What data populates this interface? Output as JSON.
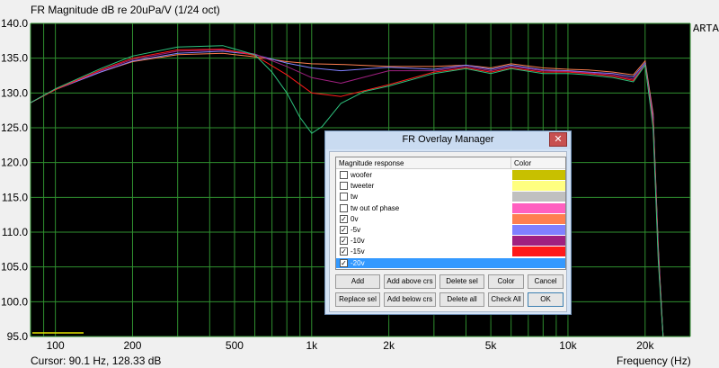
{
  "title": "FR Magnitude dB re 20uPa/V (1/24 oct)",
  "arta_label": "ARTA",
  "cursor_readout": "Cursor: 90.1 Hz, 128.33 dB",
  "chart_data": {
    "type": "line",
    "title": "FR Magnitude dB re 20uPa/V (1/24 oct)",
    "xlabel": "Frequency (Hz)",
    "ylabel": "",
    "xscale": "log",
    "xlim": [
      80,
      30000
    ],
    "ylim": [
      95,
      140
    ],
    "x_ticks": [
      100,
      200,
      500,
      1000,
      2000,
      5000,
      10000,
      20000
    ],
    "x_tick_labels": [
      "100",
      "200",
      "500",
      "1k",
      "2k",
      "5k",
      "10k",
      "20k"
    ],
    "y_ticks": [
      95,
      100,
      105,
      110,
      115,
      120,
      125,
      130,
      135,
      140
    ],
    "y_tick_labels": [
      "95.0",
      "100.0",
      "105.0",
      "110.0",
      "115.0",
      "120.0",
      "125.0",
      "130.0",
      "135.0",
      "140.0"
    ],
    "grid": true,
    "background": "#000000",
    "grid_color": "#2f8f2f",
    "series": [
      {
        "color": "#ff7f50",
        "x": [
          80,
          100,
          150,
          200,
          300,
          450,
          600,
          800,
          1000,
          1300,
          2000,
          3000,
          4000,
          5000,
          6000,
          8000,
          10000,
          12000,
          15000,
          18000,
          20000,
          21500,
          22500,
          23500
        ],
        "y": [
          128.6,
          130.5,
          133.0,
          134.5,
          135.5,
          135.7,
          135.2,
          134.5,
          134.2,
          134.1,
          133.8,
          133.8,
          134.0,
          133.6,
          134.2,
          133.6,
          133.4,
          133.3,
          133.0,
          132.6,
          134.6,
          127.0,
          108.0,
          95.0
        ]
      },
      {
        "color": "#8080ff",
        "x": [
          80,
          100,
          150,
          200,
          300,
          450,
          600,
          800,
          1000,
          1300,
          2000,
          3000,
          4000,
          5000,
          6000,
          8000,
          10000,
          12000,
          15000,
          18000,
          20000,
          21500,
          22500,
          23500
        ],
        "y": [
          128.6,
          130.5,
          133.0,
          134.6,
          135.7,
          136.0,
          135.5,
          134.3,
          133.6,
          133.2,
          133.7,
          133.4,
          134.0,
          133.4,
          134.0,
          133.3,
          133.2,
          133.0,
          132.8,
          132.3,
          134.3,
          126.5,
          107.5,
          95.0
        ]
      },
      {
        "color": "#a02080",
        "x": [
          80,
          100,
          150,
          200,
          300,
          450,
          600,
          800,
          1000,
          1300,
          2000,
          3000,
          4000,
          5000,
          6000,
          8000,
          10000,
          12000,
          15000,
          18000,
          20000,
          21500,
          22500,
          23500
        ],
        "y": [
          128.6,
          130.5,
          133.2,
          134.8,
          136.0,
          136.2,
          135.6,
          133.8,
          132.2,
          131.4,
          133.2,
          133.2,
          133.8,
          133.2,
          133.8,
          133.2,
          133.1,
          132.9,
          132.6,
          132.0,
          134.1,
          126.0,
          107.0,
          95.0
        ]
      },
      {
        "color": "#ff1a1a",
        "x": [
          80,
          100,
          150,
          200,
          300,
          450,
          600,
          800,
          1000,
          1300,
          2000,
          3000,
          4000,
          5000,
          6000,
          8000,
          10000,
          12000,
          15000,
          18000,
          20000,
          21500,
          22500,
          23500
        ],
        "y": [
          128.6,
          130.5,
          133.3,
          135.0,
          136.2,
          136.3,
          135.4,
          132.6,
          130.0,
          129.5,
          131.2,
          133.0,
          133.6,
          133.0,
          133.6,
          133.0,
          133.0,
          132.8,
          132.4,
          131.8,
          134.0,
          125.5,
          106.5,
          95.0
        ]
      },
      {
        "color": "#2ec27e",
        "x": [
          80,
          100,
          150,
          200,
          300,
          450,
          600,
          700,
          800,
          900,
          1000,
          1100,
          1300,
          1600,
          2000,
          3000,
          4000,
          5000,
          6000,
          8000,
          10000,
          12000,
          15000,
          18000,
          20000,
          21500,
          22500,
          23500
        ],
        "y": [
          128.6,
          130.6,
          133.5,
          135.3,
          136.6,
          136.8,
          135.5,
          133.0,
          130.0,
          126.5,
          124.2,
          125.2,
          128.5,
          130.2,
          131.0,
          132.8,
          133.5,
          132.8,
          133.5,
          132.8,
          132.8,
          132.6,
          132.2,
          131.6,
          134.0,
          125.0,
          106.0,
          95.0
        ]
      }
    ]
  },
  "bottom": {
    "freq_label": "Frequency (Hz)"
  },
  "dialog": {
    "title": "FR Overlay Manager",
    "close_glyph": "✕",
    "col_magnitude": "Magnitude response",
    "col_color": "Color",
    "check_glyph": "✓",
    "rows": [
      {
        "name": "woofer",
        "checked": false,
        "color": "#c8c000"
      },
      {
        "name": "tweeter",
        "checked": false,
        "color": "#ffff80"
      },
      {
        "name": "tw",
        "checked": false,
        "color": "#c0c0c0"
      },
      {
        "name": "tw out of phase",
        "checked": false,
        "color": "#ff60c0"
      },
      {
        "name": "0v",
        "checked": true,
        "color": "#ff7f50"
      },
      {
        "name": "-5v",
        "checked": true,
        "color": "#8080ff"
      },
      {
        "name": "-10v",
        "checked": true,
        "color": "#a02080"
      },
      {
        "name": "-15v",
        "checked": true,
        "color": "#ff1a1a"
      },
      {
        "name": "-20v",
        "checked": true,
        "color": "#3399ff",
        "selected": true
      }
    ],
    "buttons": {
      "add": "Add",
      "add_above": "Add above crs",
      "delete_sel": "Delete sel",
      "color": "Color",
      "cancel": "Cancel",
      "replace_sel": "Replace sel",
      "add_below": "Add below crs",
      "delete_all": "Delete all",
      "check_all": "Check All",
      "ok": "OK"
    }
  }
}
